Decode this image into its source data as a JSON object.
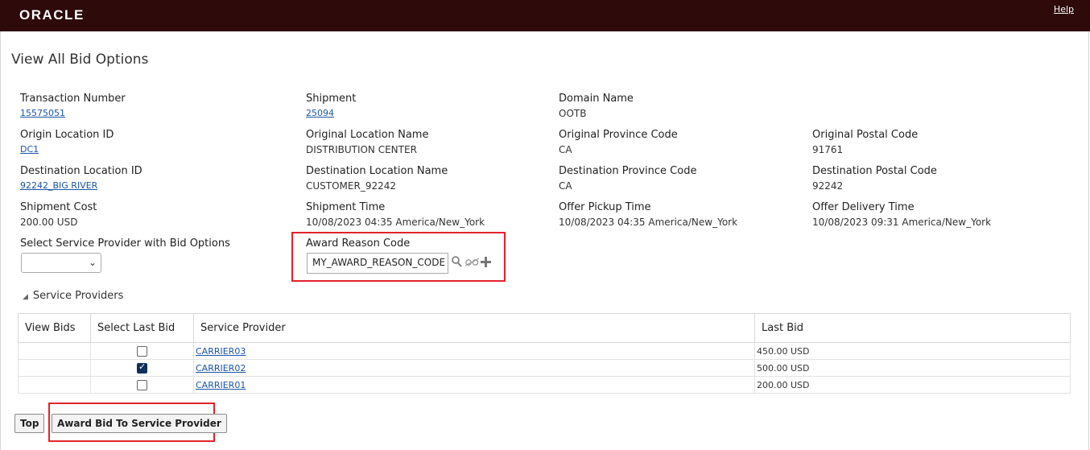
{
  "header": {
    "logo": "ORACLE",
    "help": "Help"
  },
  "page": {
    "title": "View All Bid Options"
  },
  "fields": {
    "transaction_number": {
      "label": "Transaction Number",
      "value": "15575051"
    },
    "shipment": {
      "label": "Shipment",
      "value": "25094"
    },
    "domain_name": {
      "label": "Domain Name",
      "value": "OOTB"
    },
    "origin_location_id": {
      "label": "Origin Location ID",
      "value": "DC1"
    },
    "original_location_name": {
      "label": "Original Location Name",
      "value": "DISTRIBUTION CENTER"
    },
    "original_province_code": {
      "label": "Original Province Code",
      "value": "CA"
    },
    "original_postal_code": {
      "label": "Original Postal Code",
      "value": "91761"
    },
    "destination_location_id": {
      "label": "Destination Location ID",
      "value": "92242_BIG RIVER"
    },
    "destination_location_name": {
      "label": "Destination Location Name",
      "value": "CUSTOMER_92242"
    },
    "destination_province_code": {
      "label": "Destination Province Code",
      "value": "CA"
    },
    "destination_postal_code": {
      "label": "Destination Postal Code",
      "value": "92242"
    },
    "shipment_cost": {
      "label": "Shipment Cost",
      "value": "200.00 USD"
    },
    "shipment_time": {
      "label": "Shipment Time",
      "value": "10/08/2023 04:35 America/New_York"
    },
    "offer_pickup_time": {
      "label": "Offer Pickup Time",
      "value": "10/08/2023 04:35 America/New_York"
    },
    "offer_delivery_time": {
      "label": "Offer Delivery Time",
      "value": "10/08/2023 09:31 America/New_York"
    },
    "select_service_provider": {
      "label": "Select Service Provider with Bid Options",
      "value": ""
    },
    "award_reason_code": {
      "label": "Award Reason Code",
      "value": "MY_AWARD_REASON_CODE"
    }
  },
  "icons": {
    "search": "search-icon",
    "view": "view-icon",
    "add": "plus-icon"
  },
  "service_providers": {
    "title": "Service Providers",
    "columns": [
      "View Bids",
      "Select Last Bid",
      "Service Provider",
      "Last Bid"
    ],
    "rows": [
      {
        "view_bids": "",
        "selected": false,
        "provider": "CARRIER03",
        "last_bid": "450.00 USD"
      },
      {
        "view_bids": "",
        "selected": true,
        "provider": "CARRIER02",
        "last_bid": "500.00 USD"
      },
      {
        "view_bids": "",
        "selected": false,
        "provider": "CARRIER01",
        "last_bid": "200.00 USD"
      }
    ]
  },
  "buttons": {
    "top": "Top",
    "award": "Award Bid To Service Provider"
  },
  "colors": {
    "header_bg": "#2e0a0a",
    "link": "#1a55a6",
    "highlight": "#e2232a"
  }
}
